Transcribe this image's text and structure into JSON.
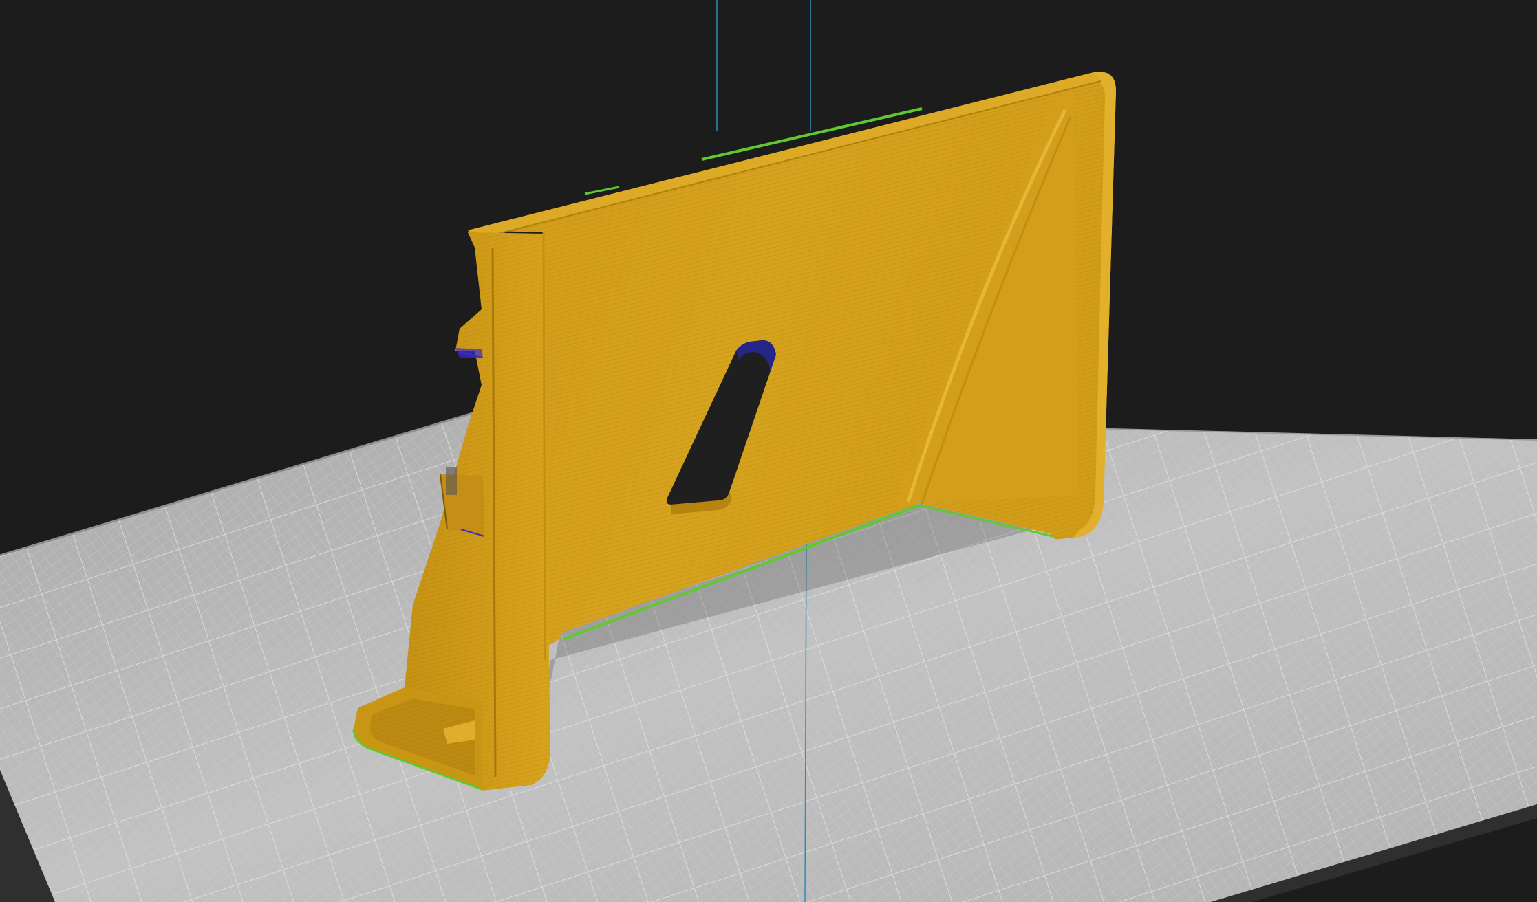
{
  "app": {
    "view": "slicer-3d-preview"
  },
  "scene": {
    "background_color": "#1c1c1c",
    "bed_color": "#bdbdbd",
    "bed_grid_color": "#d9d9d9",
    "bed_edge_color": "#4a4a4a",
    "axis_line_color": "#2a8fb8",
    "model_color": "#d6a21e",
    "model_shadow_color": "#a8790f",
    "model_highlight_color": "#e8b632",
    "travel_color": "#5fc92e",
    "travel_secondary_color": "#3a2bd6",
    "icons": [
      "bed-grid",
      "model-gcode-preview",
      "axis-line"
    ]
  }
}
